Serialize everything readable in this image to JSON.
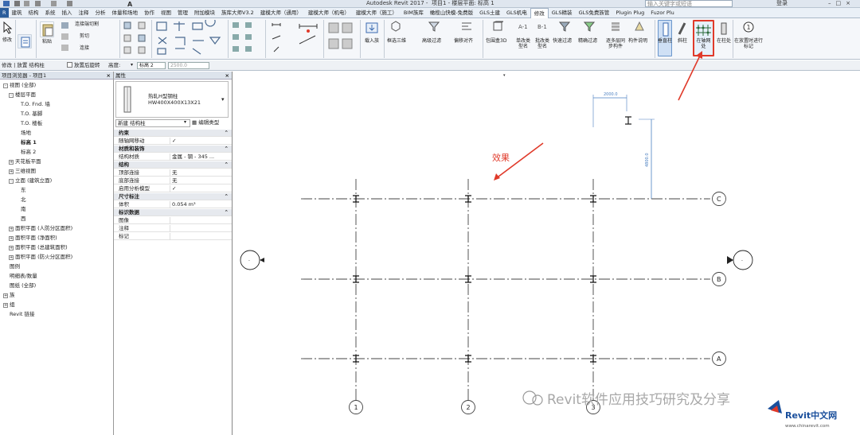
{
  "titlebar": {
    "app_title": "Autodesk Revit 2017 -",
    "project": "项目1 - 楼层平面: 标高 1",
    "search_placeholder": "输入关键字或短语",
    "user": "登录"
  },
  "menu": [
    "建筑",
    "结构",
    "系统",
    "插入",
    "注释",
    "分析",
    "体量和场地",
    "协作",
    "视图",
    "管理",
    "附加模块",
    "族库大师V3.2",
    "建模大师（通用）",
    "建模大师（机电）",
    "建模大师（施工）",
    "BIM族库",
    "橄榄山快模-免费版",
    "GLS土建",
    "GLS机电",
    "修改",
    "GLS精装",
    "GLS免费族管",
    "Plugin Plug",
    "Fuzor Plu"
  ],
  "menu_active": "修改",
  "ribbon": {
    "modify_label": "修改",
    "paste_label": "粘贴",
    "join_label": "连接端切割",
    "cut_label": "剪切",
    "connect_label": "连接",
    "load_family": "载入族",
    "frame_3d": "框选三维",
    "adv_filter": "高级过滤",
    "offset_align": "偏移对齐",
    "bbox_3d": "包围盒3D",
    "single_type": "单改类型名",
    "batch_type": "批改类型名",
    "quick_filter": "快速过滤",
    "precise_filter": "精确过滤",
    "multi_layer": "逐多层同步构件",
    "component_desc": "构件说明",
    "vertical_col": "垂直柱",
    "slanted_col": "斜柱",
    "at_grid": "在轴网处",
    "at_column": "在柱处",
    "tag_on_place": "在放置时进行标记"
  },
  "options": {
    "mode": "修改 | 放置 结构柱",
    "rotate_label": "放置后旋转",
    "depth_label": "高度:",
    "level_value": "标高 2",
    "height_value": "2500.0"
  },
  "browser": {
    "title": "项目浏览器 - 项目1",
    "items": [
      {
        "t": "视图 (全部)",
        "lv": 0,
        "tw": "-"
      },
      {
        "t": "楼层平面",
        "lv": 1,
        "tw": "-"
      },
      {
        "t": "T.O. Fnd. 墙",
        "lv": 2,
        "tw": ""
      },
      {
        "t": "T.O. 基脚",
        "lv": 2,
        "tw": ""
      },
      {
        "t": "T.O. 楼板",
        "lv": 2,
        "tw": ""
      },
      {
        "t": "场地",
        "lv": 2,
        "tw": ""
      },
      {
        "t": "标高 1",
        "lv": 2,
        "tw": "",
        "bold": true
      },
      {
        "t": "标高 2",
        "lv": 2,
        "tw": ""
      },
      {
        "t": "天花板平面",
        "lv": 1,
        "tw": "+"
      },
      {
        "t": "三维视图",
        "lv": 1,
        "tw": "+"
      },
      {
        "t": "立面 (建筑立面)",
        "lv": 1,
        "tw": "-"
      },
      {
        "t": "东",
        "lv": 2,
        "tw": ""
      },
      {
        "t": "北",
        "lv": 2,
        "tw": ""
      },
      {
        "t": "南",
        "lv": 2,
        "tw": ""
      },
      {
        "t": "西",
        "lv": 2,
        "tw": ""
      },
      {
        "t": "面积平面 (人防分区面积)",
        "lv": 1,
        "tw": "+"
      },
      {
        "t": "面积平面 (净面积)",
        "lv": 1,
        "tw": "+"
      },
      {
        "t": "面积平面 (总建筑面积)",
        "lv": 1,
        "tw": "+"
      },
      {
        "t": "面积平面 (防火分区面积)",
        "lv": 1,
        "tw": "+"
      },
      {
        "t": "图例",
        "lv": 0,
        "tw": ""
      },
      {
        "t": "明细表/数量",
        "lv": 0,
        "tw": ""
      },
      {
        "t": "图纸 (全部)",
        "lv": 0,
        "tw": ""
      },
      {
        "t": "族",
        "lv": 0,
        "tw": "+"
      },
      {
        "t": "组",
        "lv": 0,
        "tw": "+"
      },
      {
        "t": "Revit 链接",
        "lv": 0,
        "tw": ""
      }
    ]
  },
  "props": {
    "title": "属性",
    "type_name": "热轧H型钢柱",
    "type_size": "HW400X400X13X21",
    "selector": "新建 结构柱",
    "edit_type": "编辑类型",
    "rows": [
      {
        "k": "约束",
        "grp": true
      },
      {
        "k": "随轴网移动",
        "v": "✓"
      },
      {
        "k": "材质和装饰",
        "grp": true
      },
      {
        "k": "结构材质",
        "v": "金属 - 钢 - 345 ..."
      },
      {
        "k": "结构",
        "grp": true
      },
      {
        "k": "顶部连接",
        "v": "无"
      },
      {
        "k": "底部连接",
        "v": "无"
      },
      {
        "k": "启用分析模型",
        "v": "✓"
      },
      {
        "k": "尺寸标注",
        "grp": true
      },
      {
        "k": "体积",
        "v": "0.054 m³"
      },
      {
        "k": "标识数据",
        "grp": true
      },
      {
        "k": "图像",
        "v": ""
      },
      {
        "k": "注释",
        "v": ""
      },
      {
        "k": "标记",
        "v": ""
      }
    ]
  },
  "drawing": {
    "annotation": "效果",
    "dim_h": "2000.0",
    "dim_v": "4800.0",
    "grid_rows": [
      "C",
      "B",
      "A"
    ],
    "grid_cols": [
      "1",
      "2",
      "3"
    ],
    "watermark": "Revit软件应用技巧研究及分享",
    "logo": "Revit中文网",
    "logo_url": "www.chinarevit.com"
  },
  "colors": {
    "accent_red": "#e03a2a",
    "grid_line": "#444444",
    "logo_blue": "#1a4f9c"
  }
}
